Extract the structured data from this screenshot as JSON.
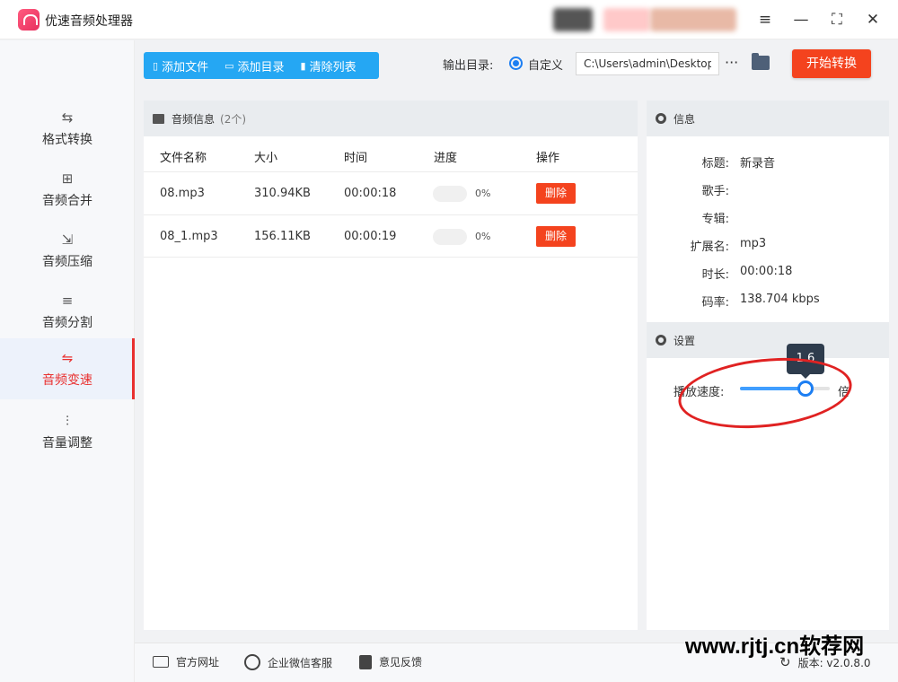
{
  "app": {
    "title": "优速音频处理器"
  },
  "window_controls": {
    "menu": "≡",
    "minimize": "—",
    "maximize": "⛶",
    "close": "✕"
  },
  "sidebar": {
    "items": [
      {
        "label": "格式转换",
        "icon": "format-convert-icon",
        "glyph": "⇆"
      },
      {
        "label": "音频合并",
        "icon": "audio-merge-icon",
        "glyph": "⊞"
      },
      {
        "label": "音频压缩",
        "icon": "audio-compress-icon",
        "glyph": "⇲"
      },
      {
        "label": "音频分割",
        "icon": "audio-split-icon",
        "glyph": "≡"
      },
      {
        "label": "音频变速",
        "icon": "audio-speed-icon",
        "glyph": "⇋"
      },
      {
        "label": "音量调整",
        "icon": "volume-adjust-icon",
        "glyph": "⫶"
      }
    ],
    "active_index": 4
  },
  "toolbar": {
    "add_file": "添加文件",
    "add_dir": "添加目录",
    "clear_list": "清除列表"
  },
  "output": {
    "label": "输出目录:",
    "option_label": "自定义",
    "path": "C:\\Users\\admin\\Desktop",
    "more": "···"
  },
  "start_button": "开始转换",
  "audio_list": {
    "title": "音频信息",
    "count": "(2个)",
    "columns": [
      "文件名称",
      "大小",
      "时间",
      "进度",
      "操作"
    ],
    "rows": [
      {
        "name": "08.mp3",
        "size": "310.94KB",
        "time": "00:00:18",
        "progress": "0%",
        "progress_value": 0,
        "action": "删除"
      },
      {
        "name": "08_1.mp3",
        "size": "156.11KB",
        "time": "00:00:19",
        "progress": "0%",
        "progress_value": 0,
        "action": "删除"
      }
    ]
  },
  "info": {
    "title": "信息",
    "fields": [
      {
        "key": "标题:",
        "value": "新录音"
      },
      {
        "key": "歌手:",
        "value": ""
      },
      {
        "key": "专辑:",
        "value": ""
      },
      {
        "key": "扩展名:",
        "value": "mp3"
      },
      {
        "key": "时长:",
        "value": "00:00:18"
      },
      {
        "key": "码率:",
        "value": "138.704 kbps"
      }
    ]
  },
  "settings": {
    "title": "设置",
    "speed_label": "播放速度:",
    "speed_value": "1.6",
    "speed_fraction": 0.73,
    "unit": "倍"
  },
  "footer": {
    "website": "官方网址",
    "wechat": "企业微信客服",
    "feedback": "意见反馈",
    "version": "版本: v2.0.8.0"
  },
  "watermark": "www.rjtj.cn软荐网",
  "colors": {
    "accent": "#e9302f",
    "toolbar": "#25a7f3",
    "start": "#f4431e",
    "slider": "#1c7ef2"
  }
}
